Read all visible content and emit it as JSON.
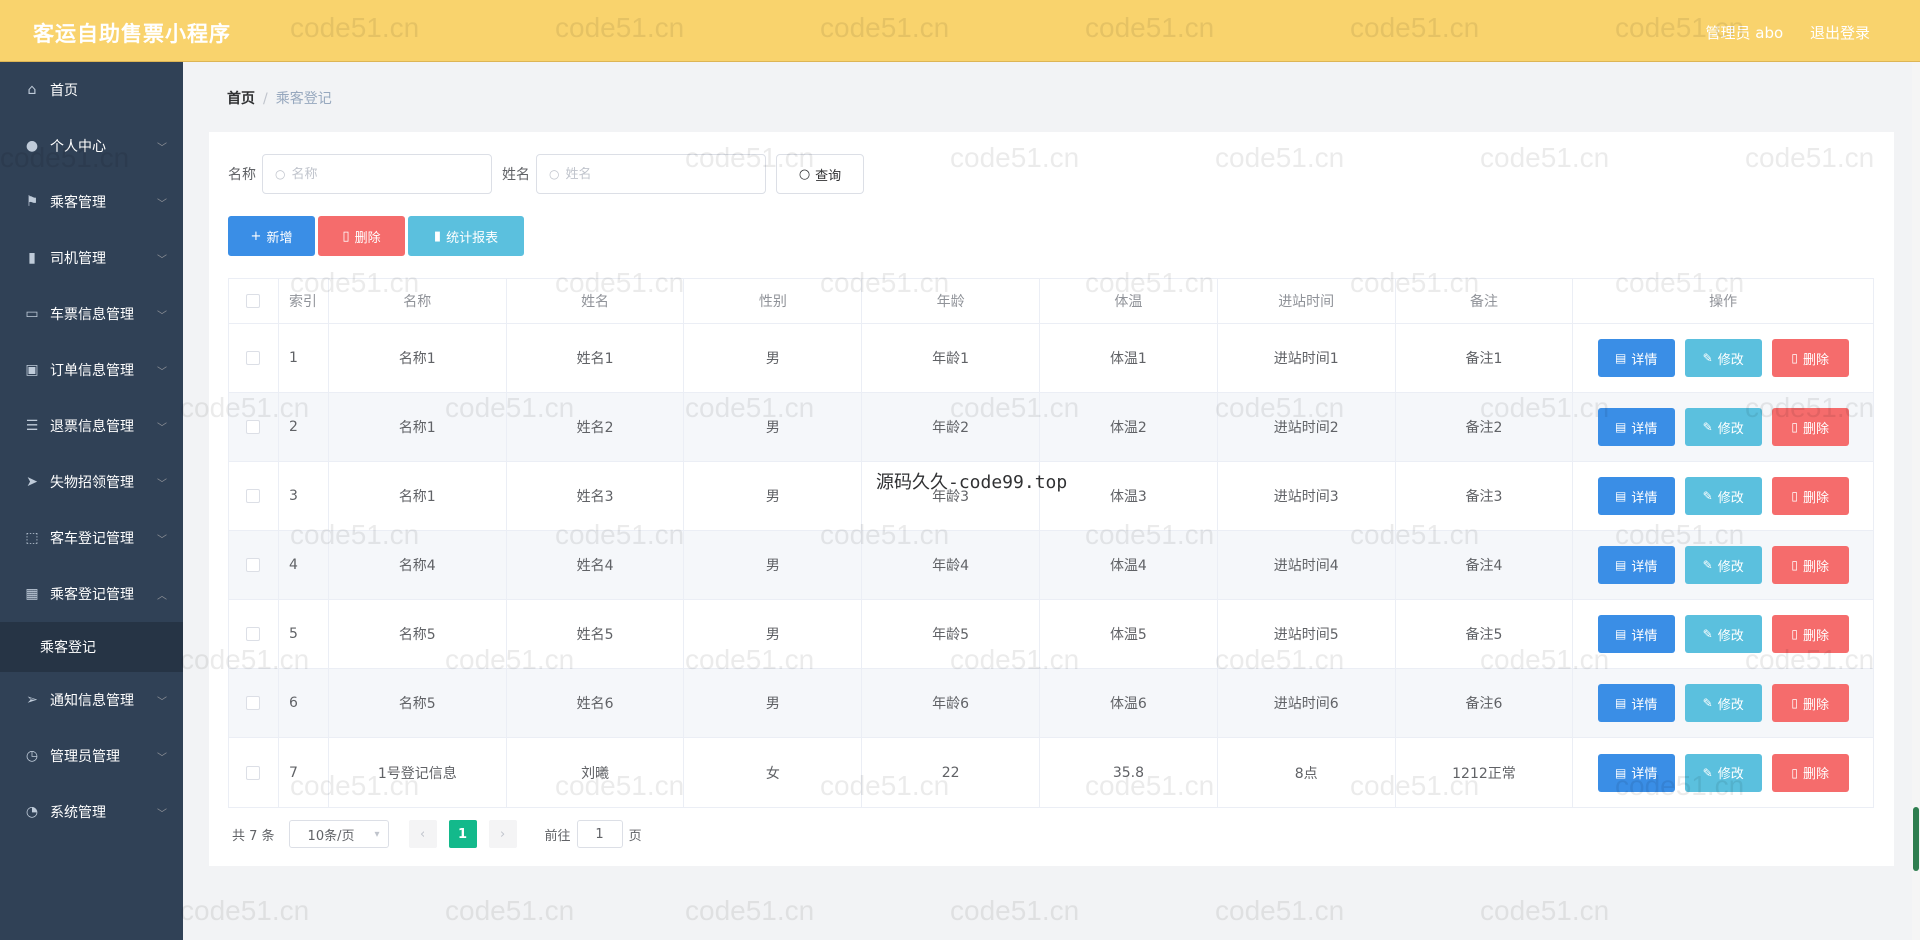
{
  "header": {
    "app_title": "客运自助售票小程序",
    "user_label": "管理员 abo",
    "logout_label": "退出登录"
  },
  "sidebar": {
    "items": [
      {
        "label": "首页",
        "icon": "home-icon",
        "glyph": "⌂",
        "expand": false
      },
      {
        "label": "个人中心",
        "icon": "user-icon",
        "glyph": "●",
        "expand": true
      },
      {
        "label": "乘客管理",
        "icon": "flag-icon",
        "glyph": "⚑",
        "expand": true
      },
      {
        "label": "司机管理",
        "icon": "chart-icon",
        "glyph": "▮",
        "expand": true
      },
      {
        "label": "车票信息管理",
        "icon": "chat-icon",
        "glyph": "▭",
        "expand": true
      },
      {
        "label": "订单信息管理",
        "icon": "clipboard-icon",
        "glyph": "▣",
        "expand": true
      },
      {
        "label": "退票信息管理",
        "icon": "list-icon",
        "glyph": "☰",
        "expand": true
      },
      {
        "label": "失物招领管理",
        "icon": "send-icon",
        "glyph": "➤",
        "expand": true
      },
      {
        "label": "客车登记管理",
        "icon": "scan-icon",
        "glyph": "⬚",
        "expand": true
      },
      {
        "label": "乘客登记管理",
        "icon": "grid-icon",
        "glyph": "▦",
        "expand": true,
        "open": true
      },
      {
        "label": "通知信息管理",
        "icon": "paper-plane-icon",
        "glyph": "➢",
        "expand": true
      },
      {
        "label": "管理员管理",
        "icon": "clock-icon",
        "glyph": "◷",
        "expand": true
      },
      {
        "label": "系统管理",
        "icon": "gauge-icon",
        "glyph": "◔",
        "expand": true
      }
    ],
    "sub_item": "乘客登记"
  },
  "breadcrumb": {
    "home": "首页",
    "current": "乘客登记"
  },
  "search": {
    "name_label": "名称",
    "name_placeholder": "名称",
    "person_label": "姓名",
    "person_placeholder": "姓名",
    "query_label": "查询"
  },
  "actions": {
    "add": "新增",
    "delete": "删除",
    "stats": "统计报表"
  },
  "table": {
    "columns": [
      "索引",
      "名称",
      "姓名",
      "性别",
      "年龄",
      "体温",
      "进站时间",
      "备注",
      "操作"
    ],
    "rows": [
      [
        "1",
        "名称1",
        "姓名1",
        "男",
        "年龄1",
        "体温1",
        "进站时间1",
        "备注1"
      ],
      [
        "2",
        "名称1",
        "姓名2",
        "男",
        "年龄2",
        "体温2",
        "进站时间2",
        "备注2"
      ],
      [
        "3",
        "名称1",
        "姓名3",
        "男",
        "年龄3",
        "体温3",
        "进站时间3",
        "备注3"
      ],
      [
        "4",
        "名称4",
        "姓名4",
        "男",
        "年龄4",
        "体温4",
        "进站时间4",
        "备注4"
      ],
      [
        "5",
        "名称5",
        "姓名5",
        "男",
        "年龄5",
        "体温5",
        "进站时间5",
        "备注5"
      ],
      [
        "6",
        "名称5",
        "姓名6",
        "男",
        "年龄6",
        "体温6",
        "进站时间6",
        "备注6"
      ],
      [
        "7",
        "1号登记信息",
        "刘曦",
        "女",
        "22",
        "35.8",
        "8点",
        "1212正常"
      ]
    ],
    "op_labels": {
      "detail": "详情",
      "edit": "修改",
      "delete": "删除"
    }
  },
  "pagination": {
    "total": "共 7 条",
    "page_size": "10条/页",
    "current_page": "1",
    "goto_prefix": "前往",
    "goto_value": "1",
    "goto_suffix": "页"
  },
  "overlay": "源码久久-code99.top",
  "watermark": "code51.cn",
  "colors": {
    "topbar": "#f9d36d",
    "sidebar": "#304156",
    "primary": "#3a8ee6",
    "info": "#5bc0de",
    "danger": "#f56c6c",
    "page_active": "#13b98b"
  }
}
